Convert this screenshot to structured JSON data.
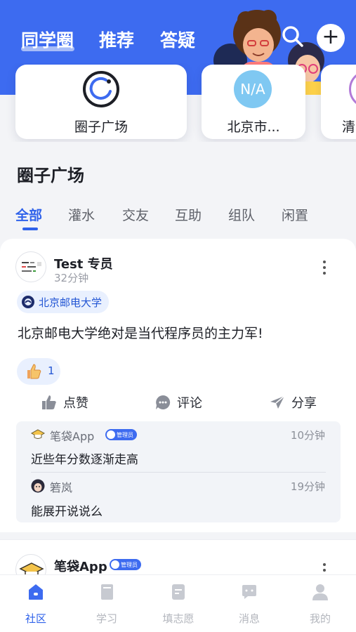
{
  "header": {
    "tabs": [
      {
        "label": "同学圈",
        "active": true
      },
      {
        "label": "推荐",
        "active": false
      },
      {
        "label": "答疑",
        "active": false
      }
    ],
    "icons": {
      "search": "search-icon",
      "add": "plus-icon"
    },
    "add_symbol": "+"
  },
  "circles": [
    {
      "label": "圈子广场",
      "icon": "circle-square-icon"
    },
    {
      "label": "北京市...",
      "icon_text": "N/A"
    },
    {
      "label": "清"
    }
  ],
  "section_title": "圈子广场",
  "filters": [
    "全部",
    "灌水",
    "交友",
    "互助",
    "组队",
    "闲置"
  ],
  "active_filter": "全部",
  "post": {
    "author": "Test 专员",
    "time": "32分钟",
    "tag": "北京邮电大学",
    "body": "北京邮电大学绝对是当代程序员的主力军!",
    "like_count": "1",
    "actions": {
      "like": "点赞",
      "comment": "评论",
      "share": "分享"
    },
    "comments": [
      {
        "name": "笔袋App",
        "badge": "管理员",
        "time": "10分钟",
        "text": "近些年分数逐渐走高"
      },
      {
        "name": "箬岚",
        "time": "19分钟",
        "text": "能展开说说么"
      }
    ]
  },
  "post2": {
    "author": "笔袋App",
    "badge": "管理员"
  },
  "tabbar": [
    {
      "label": "社区",
      "active": true
    },
    {
      "label": "学习",
      "active": false
    },
    {
      "label": "填志愿",
      "active": false
    },
    {
      "label": "消息",
      "active": false
    },
    {
      "label": "我的",
      "active": false
    }
  ],
  "colors": {
    "primary": "#3d6bf0",
    "accent": "#2f62ea",
    "tag_bg": "#e9f0fe"
  }
}
